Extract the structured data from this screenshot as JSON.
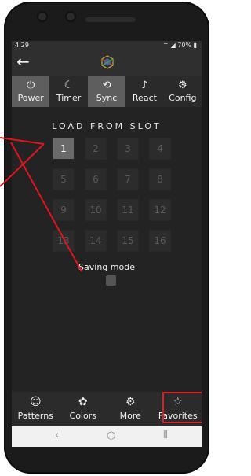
{
  "status_bar": {
    "time": "4:29",
    "battery": "70%"
  },
  "app_bar": {
    "back_icon": "arrow-left-icon",
    "logo_icon": "app-logo-icon"
  },
  "tabs": [
    {
      "label": "Power",
      "icon": "power-icon",
      "active": true
    },
    {
      "label": "Timer",
      "icon": "moon-icon",
      "active": false
    },
    {
      "label": "Sync",
      "icon": "sync-icon",
      "active": true
    },
    {
      "label": "React",
      "icon": "music-note-icon",
      "active": false
    },
    {
      "label": "Config",
      "icon": "gear-icon",
      "active": false
    }
  ],
  "slots": {
    "heading": "LOAD FROM SLOT",
    "items": [
      "1",
      "2",
      "3",
      "4",
      "5",
      "6",
      "7",
      "8",
      "9",
      "10",
      "11",
      "12",
      "13",
      "14",
      "15",
      "16"
    ],
    "selected": "1"
  },
  "saving_mode": {
    "label": "Saving mode",
    "checked": false
  },
  "bottom_nav": [
    {
      "label": "Patterns",
      "icon": "smiley-icon"
    },
    {
      "label": "Colors",
      "icon": "palette-icon"
    },
    {
      "label": "More",
      "icon": "settings-cog-icon"
    },
    {
      "label": "Favorites",
      "icon": "star-icon"
    }
  ],
  "colors": {
    "annotation_red": "#d91f26",
    "tab_active": "#5e5e5e"
  }
}
